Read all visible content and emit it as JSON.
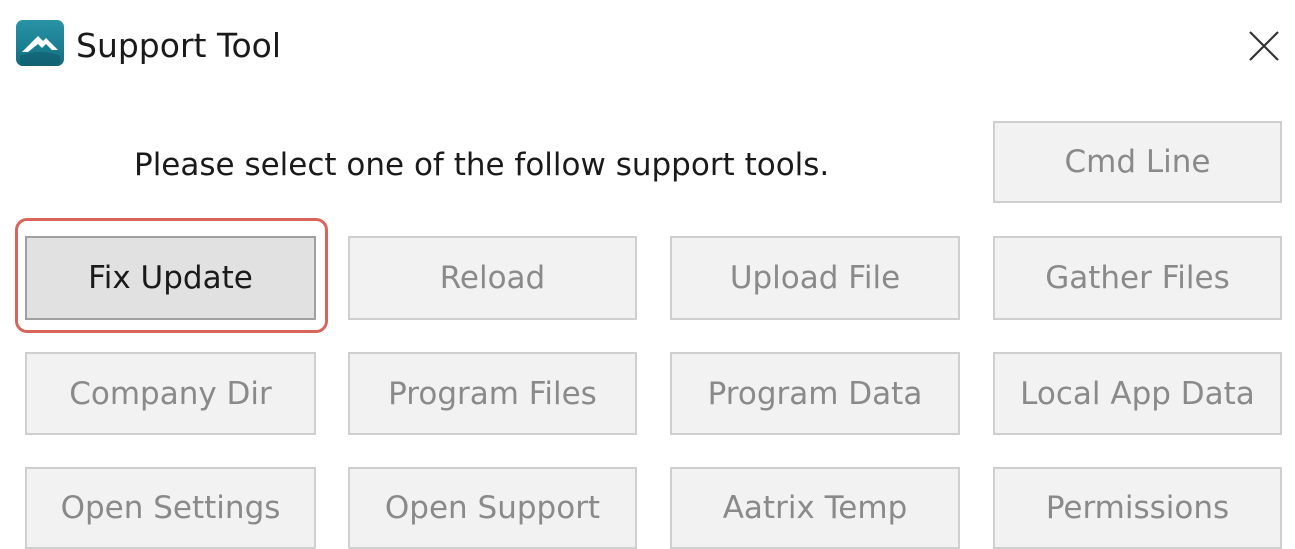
{
  "window": {
    "title": "Support Tool",
    "app_icon": "aatrix-mountain-icon",
    "close_icon": "close-icon"
  },
  "instructions": "Please select one of the follow support tools.",
  "buttons": {
    "cmd_line": "Cmd Line",
    "fix_update": "Fix Update",
    "reload": "Reload",
    "upload_file": "Upload File",
    "gather_files": "Gather Files",
    "company_dir": "Company Dir",
    "program_files": "Program Files",
    "program_data": "Program Data",
    "local_app_data": "Local App Data",
    "open_settings": "Open Settings",
    "open_support": "Open Support",
    "aatrix_temp": "Aatrix Temp",
    "permissions": "Permissions"
  },
  "colors": {
    "highlight": "#d9645a",
    "icon_teal": "#1a7e91",
    "disabled_text": "#8a8a8a"
  }
}
